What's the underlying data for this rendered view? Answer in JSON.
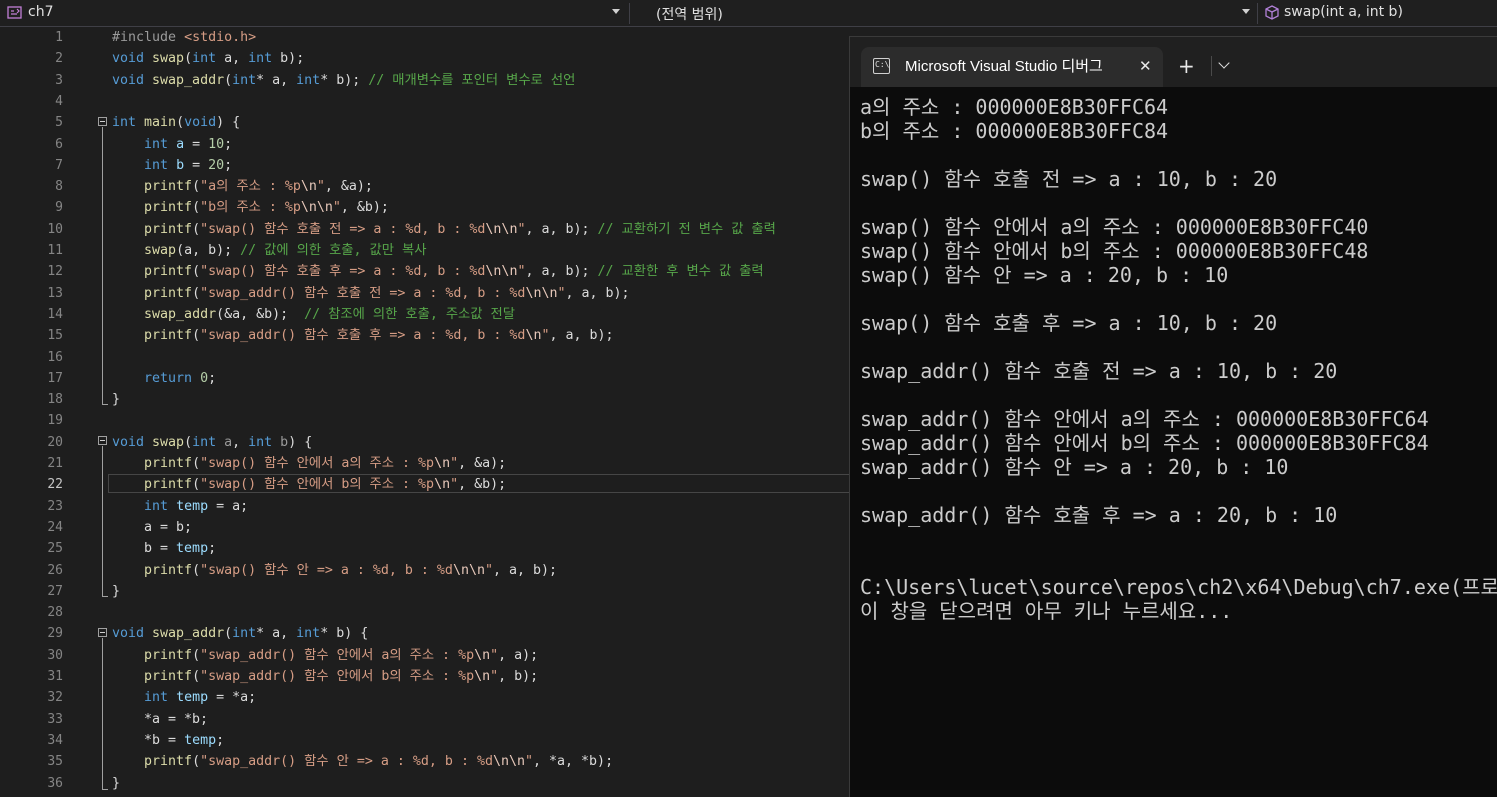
{
  "navbar": {
    "project": "ch7",
    "scope": "(전역 범위)",
    "member": "swap(int a, int b)"
  },
  "editor": {
    "current_line": 22,
    "lines": [
      {
        "n": "1",
        "code": [
          [
            "pp",
            "#include "
          ],
          [
            "hdr",
            "<stdio.h>"
          ]
        ]
      },
      {
        "n": "2",
        "code": [
          [
            "kw",
            "void "
          ],
          [
            "fn",
            "swap"
          ],
          [
            "t",
            "("
          ],
          [
            "kw",
            "int"
          ],
          [
            "t",
            " a, "
          ],
          [
            "kw",
            "int"
          ],
          [
            "t",
            " b);"
          ]
        ]
      },
      {
        "n": "3",
        "code": [
          [
            "kw",
            "void "
          ],
          [
            "fn",
            "swap_addr"
          ],
          [
            "t",
            "("
          ],
          [
            "kw",
            "int"
          ],
          [
            "t",
            "* a, "
          ],
          [
            "kw",
            "int"
          ],
          [
            "t",
            "* b); "
          ],
          [
            "cm",
            "// 매개변수를 포인터 변수로 선언"
          ]
        ]
      },
      {
        "n": "4",
        "code": []
      },
      {
        "n": "5",
        "code": [
          [
            "kw",
            "int "
          ],
          [
            "fn",
            "main"
          ],
          [
            "t",
            "("
          ],
          [
            "kw",
            "void"
          ],
          [
            "t",
            ") {"
          ]
        ]
      },
      {
        "n": "6",
        "code": [
          [
            "t",
            "    "
          ],
          [
            "kw",
            "int "
          ],
          [
            "ident",
            "a"
          ],
          [
            "t",
            " = "
          ],
          [
            "num",
            "10"
          ],
          [
            "t",
            ";"
          ]
        ]
      },
      {
        "n": "7",
        "code": [
          [
            "t",
            "    "
          ],
          [
            "kw",
            "int "
          ],
          [
            "ident",
            "b"
          ],
          [
            "t",
            " = "
          ],
          [
            "num",
            "20"
          ],
          [
            "t",
            ";"
          ]
        ]
      },
      {
        "n": "8",
        "code": [
          [
            "t",
            "    "
          ],
          [
            "fn",
            "printf"
          ],
          [
            "t",
            "("
          ],
          [
            "str",
            "\"a의 주소 : %p"
          ],
          [
            "esc",
            "\\n"
          ],
          [
            "str",
            "\""
          ],
          [
            "t",
            ", &a);"
          ]
        ]
      },
      {
        "n": "9",
        "code": [
          [
            "t",
            "    "
          ],
          [
            "fn",
            "printf"
          ],
          [
            "t",
            "("
          ],
          [
            "str",
            "\"b의 주소 : %p"
          ],
          [
            "esc",
            "\\n\\n"
          ],
          [
            "str",
            "\""
          ],
          [
            "t",
            ", &b);"
          ]
        ]
      },
      {
        "n": "10",
        "code": [
          [
            "t",
            "    "
          ],
          [
            "fn",
            "printf"
          ],
          [
            "t",
            "("
          ],
          [
            "str",
            "\"swap() 함수 호출 전 => a : %d, b : %d"
          ],
          [
            "esc",
            "\\n\\n"
          ],
          [
            "str",
            "\""
          ],
          [
            "t",
            ", a, b); "
          ],
          [
            "cm",
            "// 교환하기 전 변수 값 출력"
          ]
        ]
      },
      {
        "n": "11",
        "code": [
          [
            "t",
            "    "
          ],
          [
            "fn",
            "swap"
          ],
          [
            "t",
            "(a, b); "
          ],
          [
            "cm",
            "// 값에 의한 호출, 값만 복사"
          ]
        ]
      },
      {
        "n": "12",
        "code": [
          [
            "t",
            "    "
          ],
          [
            "fn",
            "printf"
          ],
          [
            "t",
            "("
          ],
          [
            "str",
            "\"swap() 함수 호출 후 => a : %d, b : %d"
          ],
          [
            "esc",
            "\\n\\n"
          ],
          [
            "str",
            "\""
          ],
          [
            "t",
            ", a, b); "
          ],
          [
            "cm",
            "// 교환한 후 변수 값 출력"
          ]
        ]
      },
      {
        "n": "13",
        "code": [
          [
            "t",
            "    "
          ],
          [
            "fn",
            "printf"
          ],
          [
            "t",
            "("
          ],
          [
            "str",
            "\"swap_addr() 함수 호출 전 => a : %d, b : %d"
          ],
          [
            "esc",
            "\\n\\n"
          ],
          [
            "str",
            "\""
          ],
          [
            "t",
            ", a, b);"
          ]
        ]
      },
      {
        "n": "14",
        "code": [
          [
            "t",
            "    "
          ],
          [
            "fn",
            "swap_addr"
          ],
          [
            "t",
            "(&a, &b);  "
          ],
          [
            "cm",
            "// 참조에 의한 호출, 주소값 전달"
          ]
        ]
      },
      {
        "n": "15",
        "code": [
          [
            "t",
            "    "
          ],
          [
            "fn",
            "printf"
          ],
          [
            "t",
            "("
          ],
          [
            "str",
            "\"swap_addr() 함수 호출 후 => a : %d, b : %d"
          ],
          [
            "esc",
            "\\n"
          ],
          [
            "str",
            "\""
          ],
          [
            "t",
            ", a, b);"
          ]
        ]
      },
      {
        "n": "16",
        "code": []
      },
      {
        "n": "17",
        "code": [
          [
            "t",
            "    "
          ],
          [
            "kw",
            "return "
          ],
          [
            "num",
            "0"
          ],
          [
            "t",
            ";"
          ]
        ]
      },
      {
        "n": "18",
        "code": [
          [
            "t",
            "}"
          ]
        ]
      },
      {
        "n": "19",
        "code": []
      },
      {
        "n": "20",
        "code": [
          [
            "kw",
            "void "
          ],
          [
            "fn",
            "swap"
          ],
          [
            "t",
            "("
          ],
          [
            "kw",
            "int"
          ],
          [
            "par",
            " a"
          ],
          [
            "t",
            ", "
          ],
          [
            "kw",
            "int"
          ],
          [
            "par",
            " b"
          ],
          [
            "t",
            ") {"
          ]
        ]
      },
      {
        "n": "21",
        "code": [
          [
            "t",
            "    "
          ],
          [
            "fn",
            "printf"
          ],
          [
            "t",
            "("
          ],
          [
            "str",
            "\"swap() 함수 안에서 a의 주소 : %p"
          ],
          [
            "esc",
            "\\n"
          ],
          [
            "str",
            "\""
          ],
          [
            "t",
            ", &a);"
          ]
        ]
      },
      {
        "n": "22",
        "code": [
          [
            "t",
            "    "
          ],
          [
            "fn",
            "printf"
          ],
          [
            "t",
            "("
          ],
          [
            "str",
            "\"swap() 함수 안에서 b의 주소 : %p"
          ],
          [
            "esc",
            "\\n"
          ],
          [
            "str",
            "\""
          ],
          [
            "t",
            ", &b);"
          ]
        ]
      },
      {
        "n": "23",
        "code": [
          [
            "t",
            "    "
          ],
          [
            "kw",
            "int "
          ],
          [
            "ident",
            "temp"
          ],
          [
            "t",
            " = a;"
          ]
        ]
      },
      {
        "n": "24",
        "code": [
          [
            "t",
            "    a = b;"
          ]
        ]
      },
      {
        "n": "25",
        "code": [
          [
            "t",
            "    b = "
          ],
          [
            "ident",
            "temp"
          ],
          [
            "t",
            ";"
          ]
        ]
      },
      {
        "n": "26",
        "code": [
          [
            "t",
            "    "
          ],
          [
            "fn",
            "printf"
          ],
          [
            "t",
            "("
          ],
          [
            "str",
            "\"swap() 함수 안 => a : %d, b : %d"
          ],
          [
            "esc",
            "\\n\\n"
          ],
          [
            "str",
            "\""
          ],
          [
            "t",
            ", a, b);"
          ]
        ]
      },
      {
        "n": "27",
        "code": [
          [
            "t",
            "}"
          ]
        ]
      },
      {
        "n": "28",
        "code": []
      },
      {
        "n": "29",
        "code": [
          [
            "kw",
            "void "
          ],
          [
            "fn",
            "swap_addr"
          ],
          [
            "t",
            "("
          ],
          [
            "kw",
            "int"
          ],
          [
            "t",
            "* a, "
          ],
          [
            "kw",
            "int"
          ],
          [
            "t",
            "* b) {"
          ]
        ]
      },
      {
        "n": "30",
        "code": [
          [
            "t",
            "    "
          ],
          [
            "fn",
            "printf"
          ],
          [
            "t",
            "("
          ],
          [
            "str",
            "\"swap_addr() 함수 안에서 a의 주소 : %p"
          ],
          [
            "esc",
            "\\n"
          ],
          [
            "str",
            "\""
          ],
          [
            "t",
            ", a);"
          ]
        ]
      },
      {
        "n": "31",
        "code": [
          [
            "t",
            "    "
          ],
          [
            "fn",
            "printf"
          ],
          [
            "t",
            "("
          ],
          [
            "str",
            "\"swap_addr() 함수 안에서 b의 주소 : %p"
          ],
          [
            "esc",
            "\\n"
          ],
          [
            "str",
            "\""
          ],
          [
            "t",
            ", b);"
          ]
        ]
      },
      {
        "n": "32",
        "code": [
          [
            "t",
            "    "
          ],
          [
            "kw",
            "int "
          ],
          [
            "ident",
            "temp"
          ],
          [
            "t",
            " = *a;"
          ]
        ]
      },
      {
        "n": "33",
        "code": [
          [
            "t",
            "    *a = *b;"
          ]
        ]
      },
      {
        "n": "34",
        "code": [
          [
            "t",
            "    *b = "
          ],
          [
            "ident",
            "temp"
          ],
          [
            "t",
            ";"
          ]
        ]
      },
      {
        "n": "35",
        "code": [
          [
            "t",
            "    "
          ],
          [
            "fn",
            "printf"
          ],
          [
            "t",
            "("
          ],
          [
            "str",
            "\"swap_addr() 함수 안 => a : %d, b : %d"
          ],
          [
            "esc",
            "\\n\\n"
          ],
          [
            "str",
            "\""
          ],
          [
            "t",
            ", *a, *b);"
          ]
        ]
      },
      {
        "n": "36",
        "code": [
          [
            "t",
            "}"
          ]
        ]
      }
    ]
  },
  "console": {
    "tab_title": "Microsoft Visual Studio 디버그",
    "tab_icon_text": "C:\\",
    "close_glyph": "✕",
    "new_tab_glyph": "+",
    "output": [
      "a의 주소 : 000000E8B30FFC64",
      "b의 주소 : 000000E8B30FFC84",
      "",
      "swap() 함수 호출 전 => a : 10, b : 20",
      "",
      "swap() 함수 안에서 a의 주소 : 000000E8B30FFC40",
      "swap() 함수 안에서 b의 주소 : 000000E8B30FFC48",
      "swap() 함수 안 => a : 20, b : 10",
      "",
      "swap() 함수 호출 후 => a : 10, b : 20",
      "",
      "swap_addr() 함수 호출 전 => a : 10, b : 20",
      "",
      "swap_addr() 함수 안에서 a의 주소 : 000000E8B30FFC64",
      "swap_addr() 함수 안에서 b의 주소 : 000000E8B30FFC84",
      "swap_addr() 함수 안 => a : 20, b : 10",
      "",
      "swap_addr() 함수 호출 후 => a : 20, b : 10",
      "",
      "",
      "C:\\Users\\lucet\\source\\repos\\ch2\\x64\\Debug\\ch7.exe(프로",
      "이 창을 닫으려면 아무 키나 누르세요..."
    ]
  }
}
